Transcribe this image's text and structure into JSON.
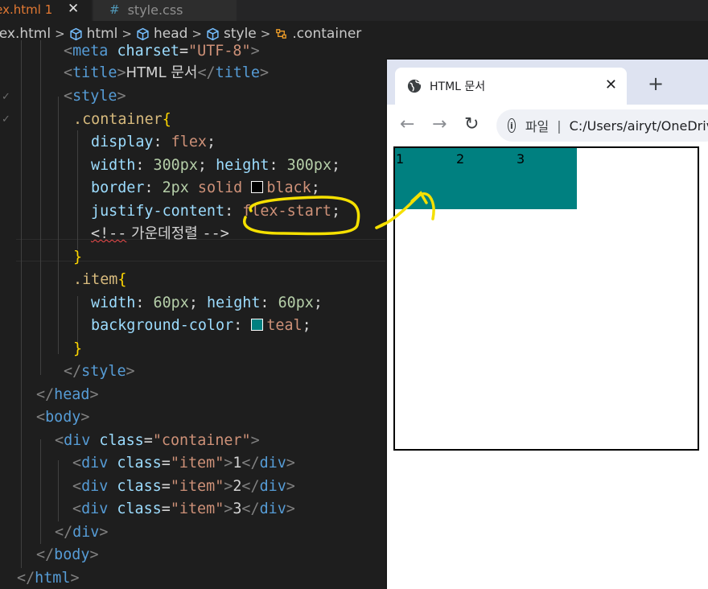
{
  "editor": {
    "tabs": [
      {
        "label": "lex.html",
        "modified": "1",
        "close": "✕"
      },
      {
        "label": "style.css",
        "icon": "#"
      }
    ],
    "breadcrumb": [
      {
        "label": "lex.html",
        "icon": "file-icon"
      },
      {
        "label": "html",
        "icon": "cube-icon"
      },
      {
        "label": "head",
        "icon": "cube-icon"
      },
      {
        "label": "style",
        "icon": "cube-icon"
      },
      {
        "label": ".container",
        "icon": "selector-icon"
      }
    ],
    "code": {
      "l1_tag": "meta",
      "l1_attr": "charset",
      "l1_val": "\"UTF-8\"",
      "l2_tag": "title",
      "l2_text": "HTML 문서",
      "l3_tag": "style",
      "l4_sel": ".container",
      "l5_prop": "display",
      "l5_val": "flex",
      "l6_prop1": "width",
      "l6_val1": "300px",
      "l6_prop2": "height",
      "l6_val2": "300px",
      "l7_prop": "border",
      "l7_v1": "2px",
      "l7_v2": "solid",
      "l7_v3": "black",
      "l8_prop": "justify-content",
      "l8_val": "flex-start",
      "l9_open": "<!--",
      "l9_text": " 가운데정렬 ",
      "l9_close": "-->",
      "l11_sel": ".item",
      "l12_prop1": "width",
      "l12_val1": "60px",
      "l12_prop2": "height",
      "l12_val2": "60px",
      "l13_prop": "background-color",
      "l13_val": "teal",
      "l16_tag": "head",
      "l17_tag": "body",
      "l18_tag": "div",
      "l18_attr": "class",
      "l18_val": "\"container\"",
      "item_tag": "div",
      "item_attr": "class",
      "item_val": "\"item\"",
      "items": [
        "1",
        "2",
        "3"
      ],
      "l22_tag": "div",
      "l23_tag": "body",
      "l24_tag": "html"
    }
  },
  "browser": {
    "tab_title": "HTML 문서",
    "tab_close": "✕",
    "new_tab": "+",
    "back": "←",
    "forward": "→",
    "reload": "↻",
    "info": "i",
    "scheme": "파일",
    "separator": "|",
    "url": "C:/Users/airyt/OneDrive",
    "items": [
      "1",
      "2",
      "3"
    ]
  },
  "colors": {
    "editor_bg": "#1e1e1e",
    "teal": "#008080",
    "annotation": "#f5e000"
  }
}
